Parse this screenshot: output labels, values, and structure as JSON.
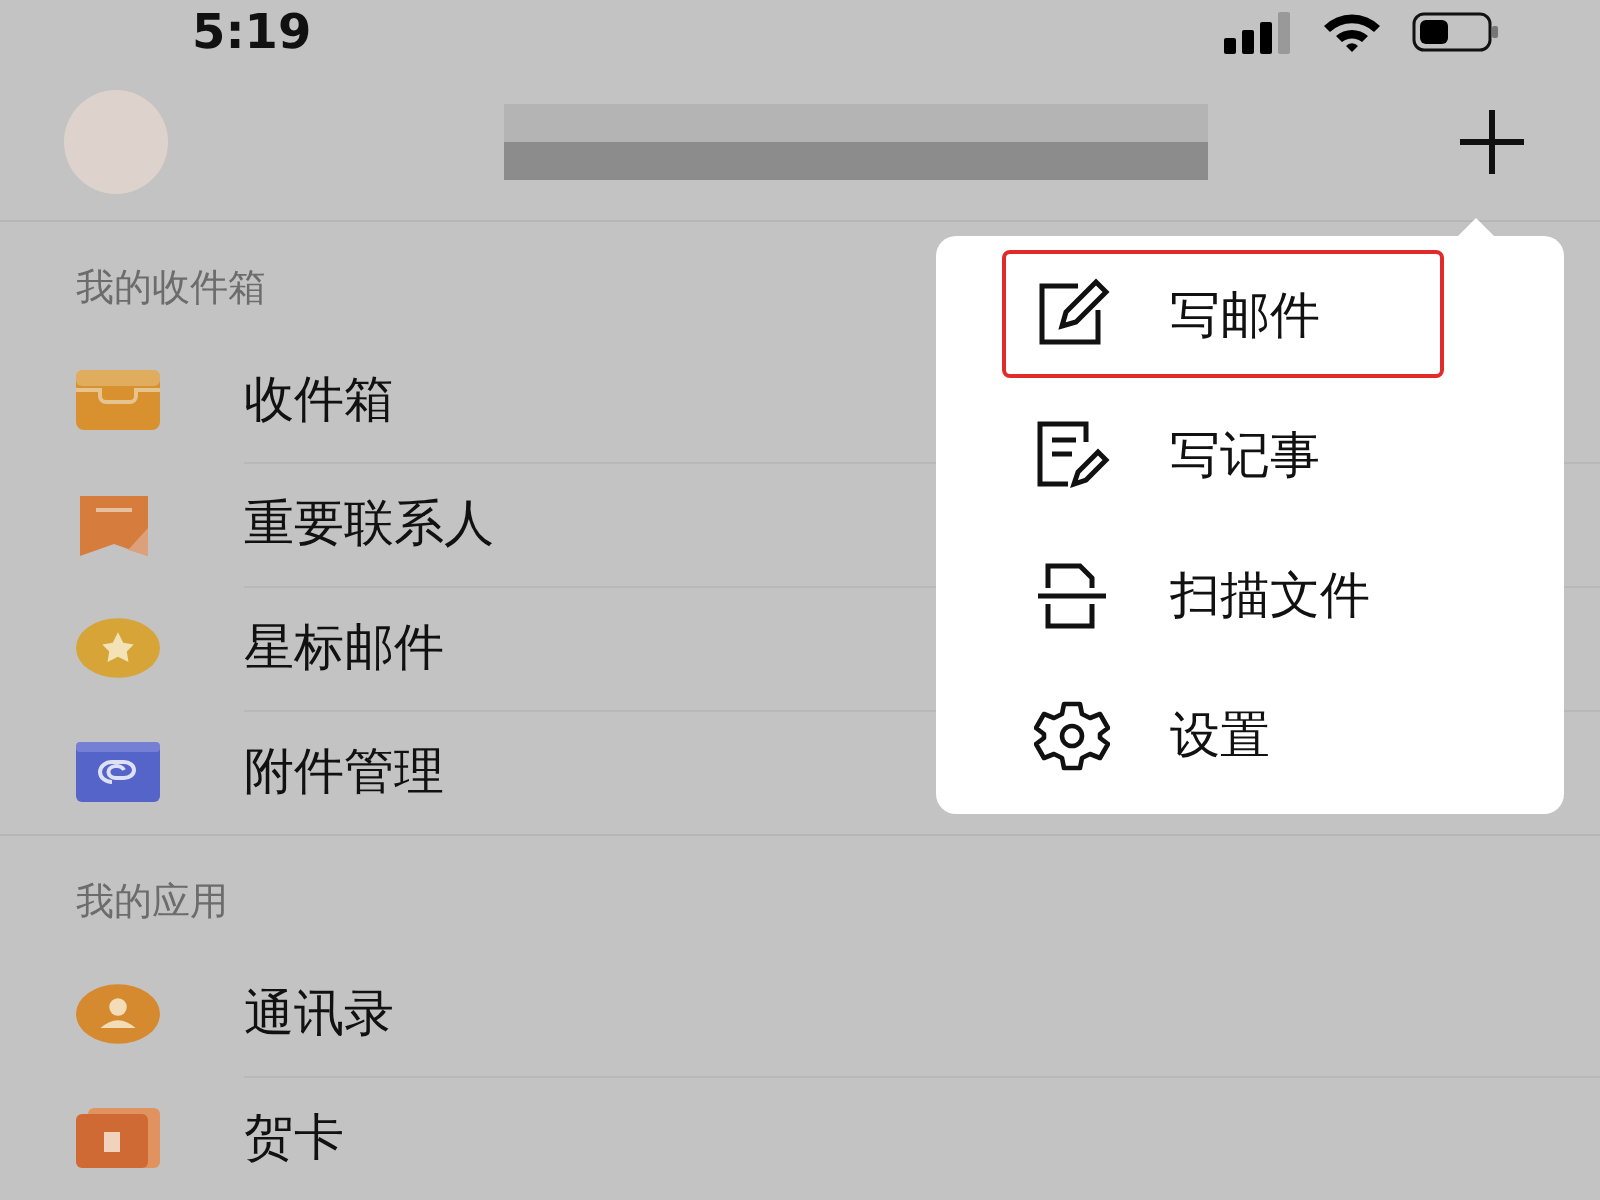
{
  "status_bar": {
    "time": "5:19"
  },
  "sections": [
    {
      "title": "我的收件箱",
      "items": [
        {
          "label": "收件箱",
          "kind": "inbox"
        },
        {
          "label": "重要联系人",
          "kind": "vip"
        },
        {
          "label": "星标邮件",
          "kind": "star"
        },
        {
          "label": "附件管理",
          "kind": "attachment"
        }
      ]
    },
    {
      "title": "我的应用",
      "items": [
        {
          "label": "通讯录",
          "kind": "contacts"
        },
        {
          "label": "贺卡",
          "kind": "card"
        }
      ]
    }
  ],
  "menu": {
    "items": [
      {
        "label": "写邮件",
        "kind": "compose",
        "highlighted": true
      },
      {
        "label": "写记事",
        "kind": "note",
        "highlighted": false
      },
      {
        "label": "扫描文件",
        "kind": "scan",
        "highlighted": false
      },
      {
        "label": "设置",
        "kind": "settings",
        "highlighted": false
      }
    ]
  }
}
